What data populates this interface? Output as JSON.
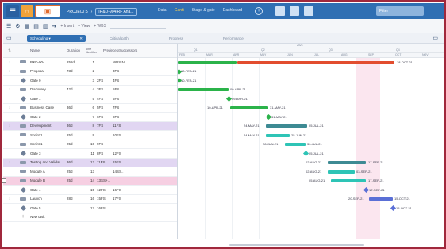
{
  "topbar": {
    "project": "PROJECTS",
    "breadcrumb": "[R&D-904]RF Ana...",
    "nav": [
      "Data",
      "Gantt",
      "Stage & gate",
      "Dashboard"
    ],
    "active_nav": "Gantt",
    "filter_label": "Filter"
  },
  "toolbar": {
    "insert_label": "+ Insert",
    "view_label": "+ View",
    "wbs_label": "+ WBS"
  },
  "tabs": [
    "Scheduling",
    "Critical path",
    "Progress",
    "Performance"
  ],
  "grid": {
    "headers": {
      "name": "Name",
      "duration": "Duration",
      "line_id": "Line identifier",
      "pred": "Predecessors",
      "succ": "Successors"
    },
    "rows": [
      {
        "name": "R&D-904",
        "duration": "258d",
        "id": "1",
        "pred": "",
        "succ": "WBS N..",
        "type": "summary"
      },
      {
        "name": "Proposal",
        "duration": "73d",
        "id": "2",
        "pred": "",
        "succ": "3FS",
        "type": "task"
      },
      {
        "name": "Gate 0",
        "duration": "",
        "id": "3",
        "pred": "2FS",
        "succ": "4FS",
        "type": "milestone"
      },
      {
        "name": "Discovery",
        "duration": "42d",
        "id": "4",
        "pred": "3FS",
        "succ": "5FS",
        "type": "task"
      },
      {
        "name": "Gate 1",
        "duration": "",
        "id": "5",
        "pred": "4FS",
        "succ": "6FS",
        "type": "milestone"
      },
      {
        "name": "Business Case",
        "duration": "36d",
        "id": "6",
        "pred": "5FS",
        "succ": "7FS",
        "type": "task"
      },
      {
        "name": "Gate 2",
        "duration": "",
        "id": "7",
        "pred": "6FS",
        "succ": "8FS",
        "type": "milestone"
      },
      {
        "name": "Development",
        "duration": "36d",
        "id": "8",
        "pred": "7FS",
        "succ": "11FS",
        "type": "summary"
      },
      {
        "name": "Sprint 1",
        "duration": "25d",
        "id": "9",
        "pred": "",
        "succ": "10FS",
        "type": "task"
      },
      {
        "name": "Sprint 1",
        "duration": "25d",
        "id": "10",
        "pred": "9FS",
        "succ": "",
        "type": "task"
      },
      {
        "name": "Gate 3",
        "duration": "",
        "id": "11",
        "pred": "8FS",
        "succ": "12FS",
        "type": "milestone"
      },
      {
        "name": "Testing and Validat..",
        "duration": "36d",
        "id": "12",
        "pred": "11FS",
        "succ": "15FS",
        "type": "summary2"
      },
      {
        "name": "Module A",
        "duration": "25d",
        "id": "13",
        "pred": "",
        "succ": "14SS..",
        "type": "task"
      },
      {
        "name": "Module B",
        "duration": "25d",
        "id": "14",
        "pred": "13SS+..",
        "succ": "",
        "type": "task-sel"
      },
      {
        "name": "Gate 4",
        "duration": "",
        "id": "15",
        "pred": "12FS",
        "succ": "16FS",
        "type": "milestone"
      },
      {
        "name": "Launch",
        "duration": "28d",
        "id": "16",
        "pred": "15FS",
        "succ": "17FS",
        "type": "task"
      },
      {
        "name": "Gate 5",
        "duration": "",
        "id": "17",
        "pred": "16FS",
        "succ": "",
        "type": "milestone"
      },
      {
        "name": "New task",
        "duration": "",
        "id": "",
        "pred": "",
        "succ": "",
        "type": "new"
      }
    ]
  },
  "timeline": {
    "year": "2021",
    "quarters": [
      "Q1",
      "Q2",
      "Q3",
      "Q4"
    ],
    "months": [
      "FEB",
      "MAR",
      "APR",
      "MAY",
      "JUN",
      "JUL",
      "AUG",
      "SEP",
      "OCT",
      "NOV"
    ],
    "labels": {
      "summary_end": "18-OCT-21",
      "gate0a": "10-FEB-21",
      "gate0b": "10-FEB-21",
      "disc_start": "11-F",
      "disc_end": "09-APR-21",
      "gate1": "09-APR-21",
      "bc_start": "10-APR-21",
      "bc_end": "31-MAY-21",
      "gate2": "31-MAY-21",
      "dev_start": "24-MAY-21",
      "dev_end": "05-JUL-21",
      "s1_start": "24-MAY-21",
      "s1_end": "25-JUN-21",
      "s2_start": "28-JUN-21",
      "s2_end": "30-JUL-21",
      "gate3": "05-JUL-21",
      "tv_start": "02-AUG-21",
      "tv_end": "17-SEP-21",
      "ma_start": "02-AUG-21",
      "ma_end": "03-SEP-21",
      "mb_start": "05-AUG-21",
      "mb_end": "17-SEP-21",
      "gate4": "17-SEP-21",
      "l_start": "20-SEP-21",
      "l_end": "15-OCT-21",
      "gate5": "15-OCT-21"
    }
  }
}
